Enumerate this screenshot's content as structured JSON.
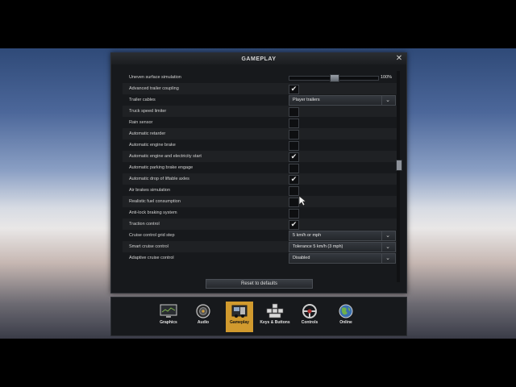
{
  "window": {
    "title": "GAMEPLAY",
    "close_label": "✕"
  },
  "settings": {
    "slider_row": {
      "label": "Uneven surface simulation",
      "value_text": "100%",
      "value_fraction": 0.5
    },
    "rows": [
      {
        "label": "Advanced trailer coupling",
        "type": "checkbox",
        "checked": true
      },
      {
        "label": "Trailer cables",
        "type": "dropdown",
        "value": "Player trailers"
      },
      {
        "label": "Truck speed limiter",
        "type": "checkbox",
        "checked": false
      },
      {
        "label": "Rain sensor",
        "type": "checkbox",
        "checked": false
      },
      {
        "label": "Automatic retarder",
        "type": "checkbox",
        "checked": false
      },
      {
        "label": "Automatic engine brake",
        "type": "checkbox",
        "checked": false
      },
      {
        "label": "Automatic engine and electricity start",
        "type": "checkbox",
        "checked": true
      },
      {
        "label": "Automatic parking brake engage",
        "type": "checkbox",
        "checked": false
      },
      {
        "label": "Automatic drop of liftable axles",
        "type": "checkbox",
        "checked": true
      },
      {
        "label": "Air brakes simulation",
        "type": "checkbox",
        "checked": false
      },
      {
        "label": "Realistic fuel consumption",
        "type": "checkbox",
        "checked": false
      },
      {
        "label": "Anti-lock braking system",
        "type": "checkbox",
        "checked": false
      },
      {
        "label": "Traction control",
        "type": "checkbox",
        "checked": true
      },
      {
        "label": "Cruise control grid step",
        "type": "dropdown",
        "value": "5 km/h or mph"
      },
      {
        "label": "Smart cruise control",
        "type": "dropdown",
        "value": "Tolerance 5 km/h (3 mph)"
      },
      {
        "label": "Adaptive cruise control",
        "type": "dropdown",
        "value": "Disabled"
      }
    ],
    "check_glyph": "✔",
    "dropdown_arrow": "⌄"
  },
  "reset_button_label": "Reset to defaults",
  "tabs": [
    {
      "label": "Graphics",
      "icon": "monitor-icon",
      "active": false
    },
    {
      "label": "Audio",
      "icon": "speaker-icon",
      "active": false
    },
    {
      "label": "Gameplay",
      "icon": "truck-icon",
      "active": true
    },
    {
      "label": "Keys & Buttons",
      "icon": "keys-icon",
      "active": false
    },
    {
      "label": "Controls",
      "icon": "steering-wheel-icon",
      "active": false
    },
    {
      "label": "Online",
      "icon": "globe-icon",
      "active": false
    }
  ],
  "colors": {
    "panel_bg": "#17191c",
    "active_tab": "#d19a2e",
    "text": "#d2d2d2"
  }
}
